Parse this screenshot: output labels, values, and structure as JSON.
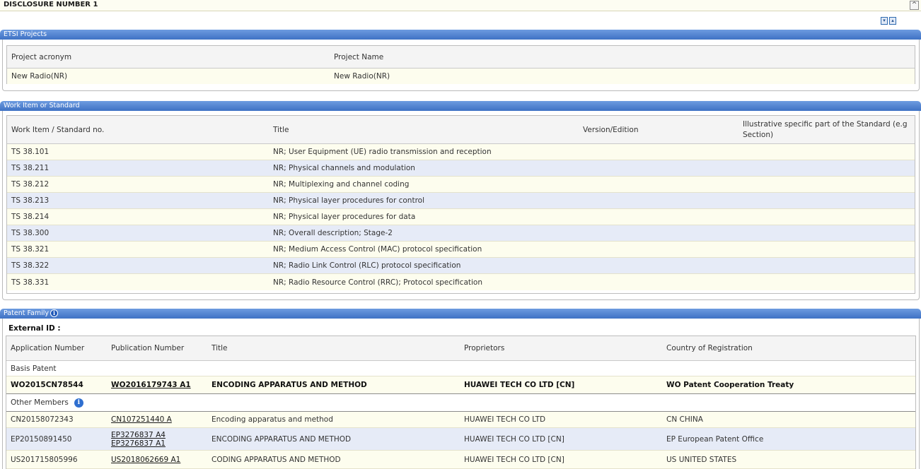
{
  "header": {
    "title": "DISCLOSURE NUMBER 1",
    "collapse_glyph": "^"
  },
  "toolbar": {
    "icons": [
      "expand-all-icon",
      "collapse-all-icon"
    ]
  },
  "etsi_projects": {
    "title": "ETSI Projects",
    "columns": [
      "Project acronym",
      "Project Name"
    ],
    "rows": [
      [
        "New Radio(NR)",
        "New Radio(NR)"
      ]
    ]
  },
  "work_items": {
    "title": "Work Item or Standard",
    "columns": [
      "Work Item / Standard no.",
      "Title",
      "Version/Edition",
      "Illustrative specific part of the Standard (e.g Section)"
    ],
    "rows": [
      [
        "TS 38.101",
        "NR; User Equipment (UE) radio transmission and reception",
        "",
        ""
      ],
      [
        "TS 38.211",
        "NR; Physical channels and modulation",
        "",
        ""
      ],
      [
        "TS 38.212",
        "NR; Multiplexing and channel coding",
        "",
        ""
      ],
      [
        "TS 38.213",
        "NR; Physical layer procedures for control",
        "",
        ""
      ],
      [
        "TS 38.214",
        "NR; Physical layer procedures for data",
        "",
        ""
      ],
      [
        "TS 38.300",
        "NR; Overall description; Stage-2",
        "",
        ""
      ],
      [
        "TS 38.321",
        "NR; Medium Access Control (MAC) protocol specification",
        "",
        ""
      ],
      [
        "TS 38.322",
        "NR; Radio Link Control (RLC) protocol specification",
        "",
        ""
      ],
      [
        "TS 38.331",
        "NR; Radio Resource Control (RRC); Protocol specification",
        "",
        ""
      ]
    ]
  },
  "patent_family": {
    "title": "Patent Family",
    "external_id_label": "External ID :",
    "columns": [
      "Application Number",
      "Publication Number",
      "Title",
      "Proprietors",
      "Country of Registration"
    ],
    "basis_label": "Basis Patent",
    "basis": {
      "application": "WO2015CN78544",
      "publication": "WO2016179743 A1",
      "title": "ENCODING APPARATUS AND METHOD",
      "proprietors": "HUAWEI TECH CO LTD [CN]",
      "country": "WO Patent Cooperation Treaty"
    },
    "other_members_label": "Other Members",
    "members": [
      {
        "application": "CN20158072343",
        "publications": [
          "CN107251440 A"
        ],
        "title": "Encoding apparatus and method",
        "proprietors": "HUAWEI TECH CO LTD",
        "country": "CN CHINA"
      },
      {
        "application": "EP20150891450",
        "publications": [
          "EP3276837 A4",
          "EP3276837 A1"
        ],
        "title": "ENCODING APPARATUS AND METHOD",
        "proprietors": "HUAWEI TECH CO LTD [CN]",
        "country": "EP European Patent Office"
      },
      {
        "application": "US201715805996",
        "publications": [
          "US2018062669 A1"
        ],
        "title": "CODING APPARATUS AND METHOD",
        "proprietors": "HUAWEI TECH CO LTD [CN]",
        "country": "US UNITED STATES"
      }
    ]
  }
}
